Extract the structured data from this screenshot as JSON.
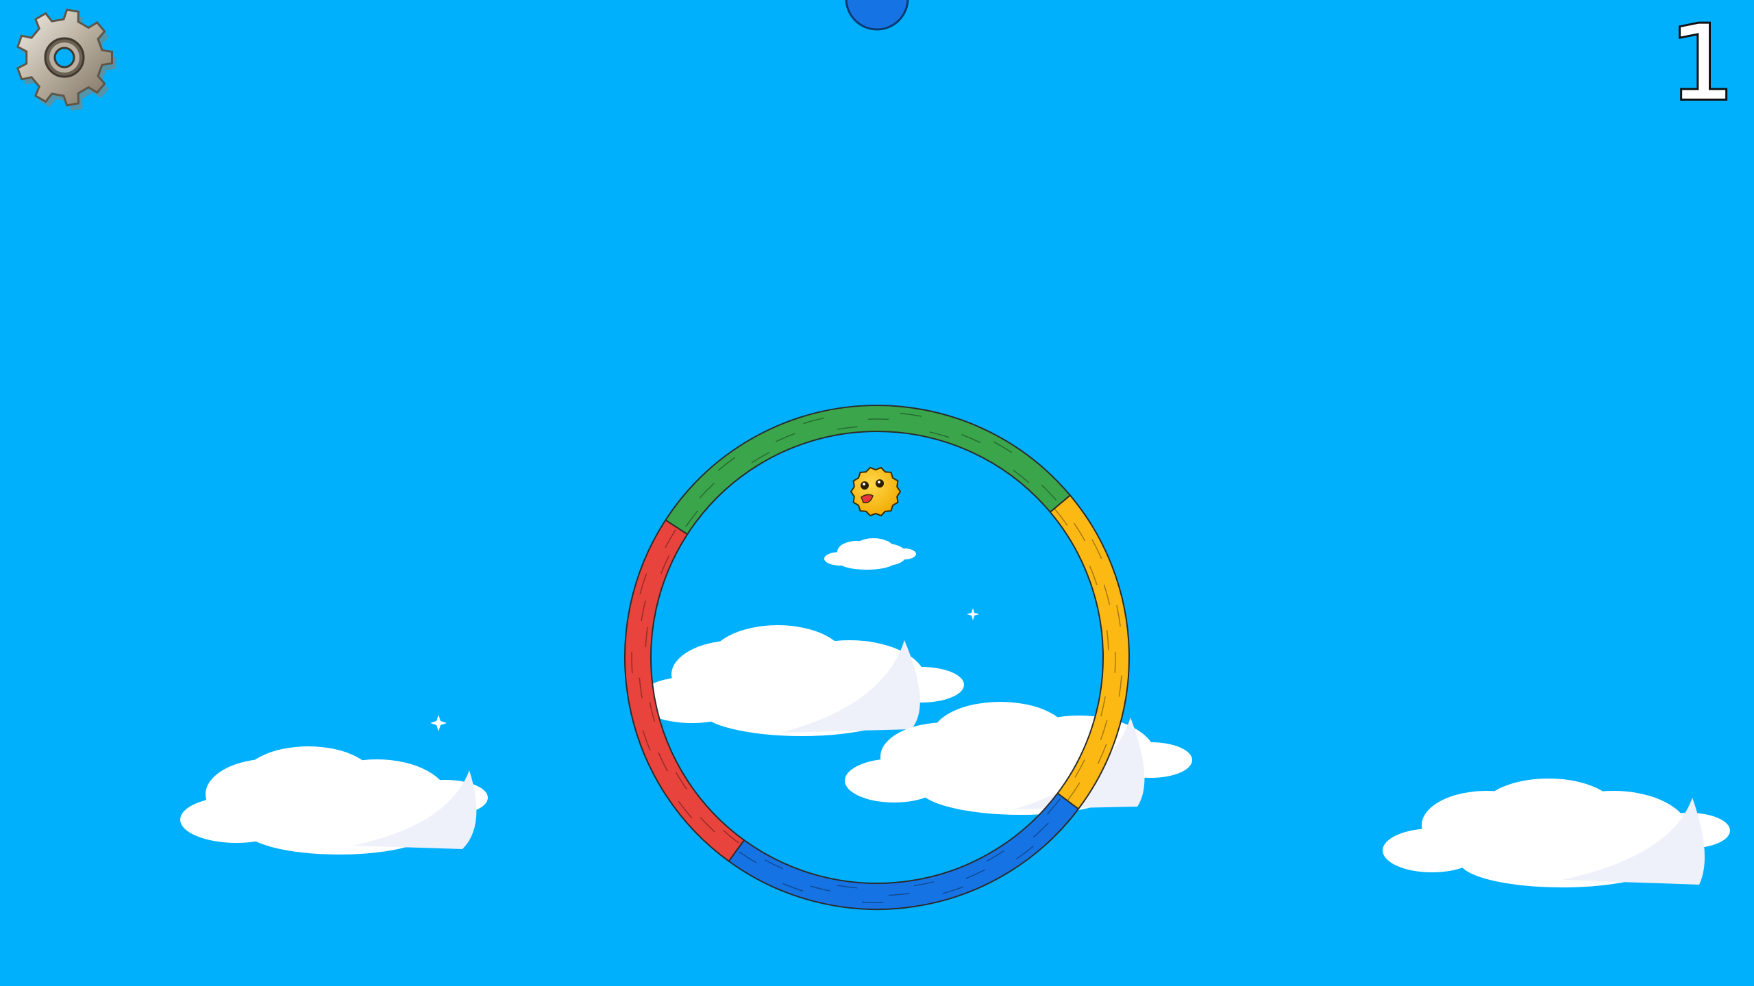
{
  "game": {
    "score": "1",
    "settings_icon": "gear-icon",
    "sky_color": "#00b0fc",
    "ring_segments": [
      {
        "color": "#3aa54a",
        "name": "green"
      },
      {
        "color": "#fdb913",
        "name": "yellow"
      },
      {
        "color": "#1673e4",
        "name": "blue"
      },
      {
        "color": "#e8433c",
        "name": "red"
      }
    ],
    "player_color": "#fcc01f",
    "next_ball_color": "#1673e4",
    "cloud_color": "#ffffff"
  }
}
